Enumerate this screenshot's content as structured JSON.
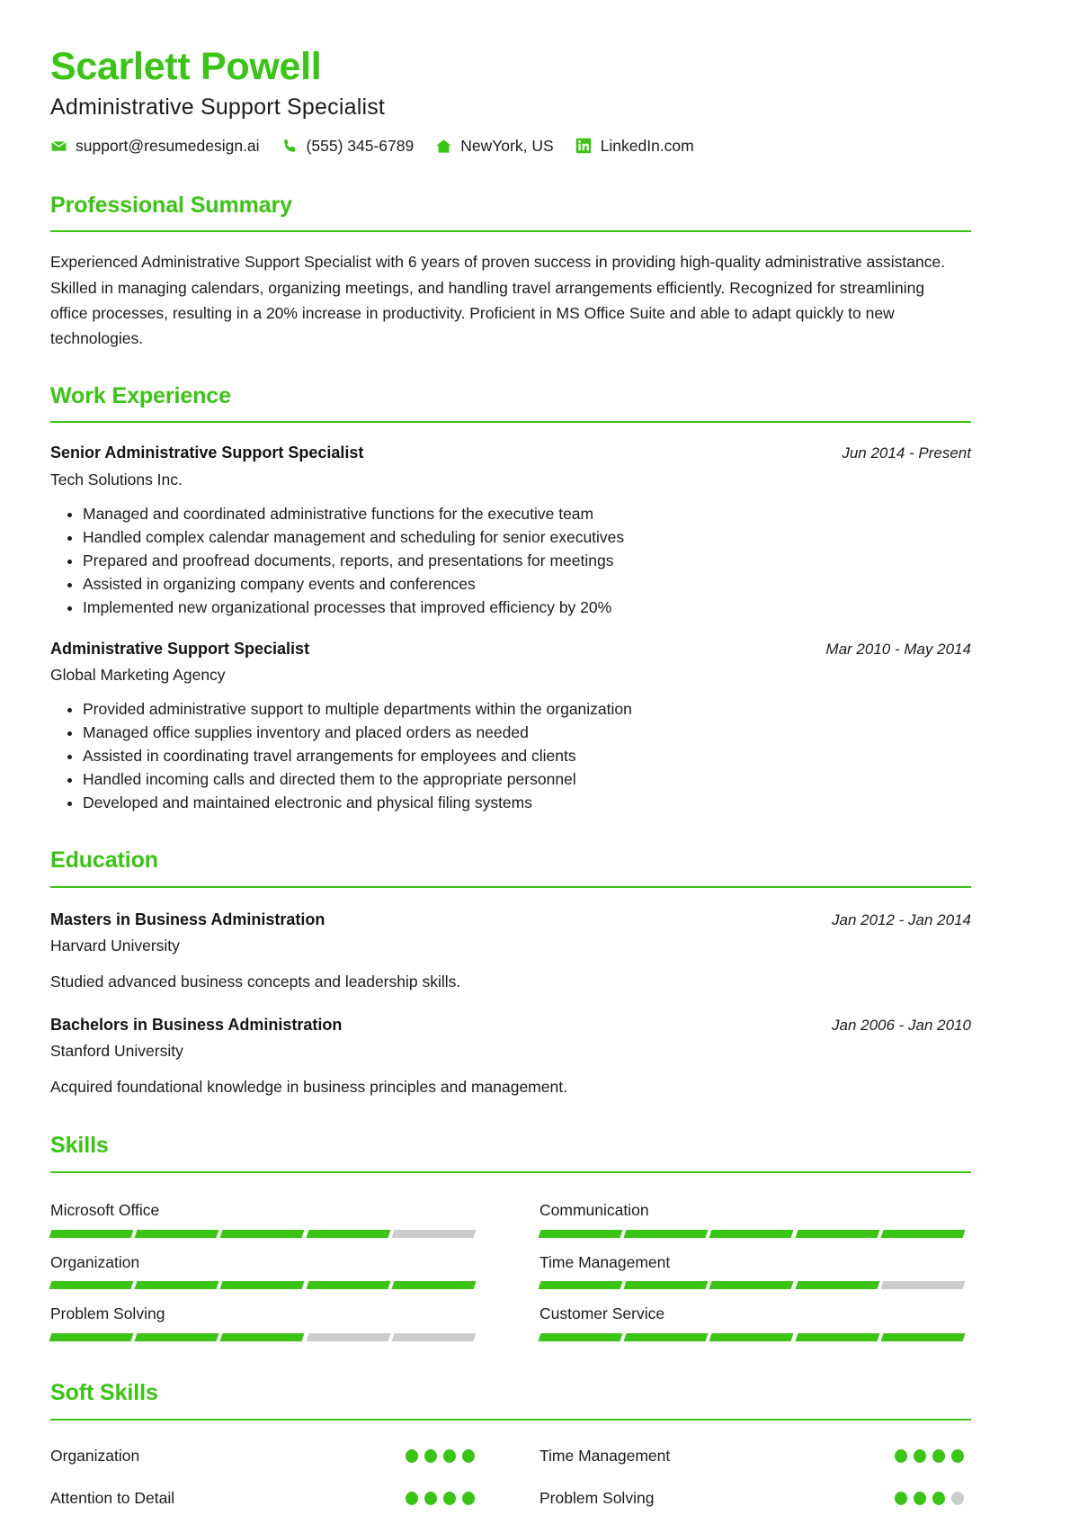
{
  "theme": {
    "accent": "#3ac413",
    "text": "#1c1c1c",
    "muted_bar": "#cccccc"
  },
  "header": {
    "name": "Scarlett Powell",
    "job_title": "Administrative Support Specialist",
    "contacts": [
      {
        "icon": "envelope-icon",
        "text": "support@resumedesign.ai"
      },
      {
        "icon": "phone-icon",
        "text": "(555) 345-6789"
      },
      {
        "icon": "home-icon",
        "text": "NewYork, US"
      },
      {
        "icon": "linkedin-icon",
        "text": "LinkedIn.com"
      }
    ]
  },
  "summary": {
    "heading": "Professional Summary",
    "text": "Experienced Administrative Support Specialist with 6 years of proven success in providing high-quality administrative assistance. Skilled in managing calendars, organizing meetings, and handling travel arrangements efficiently. Recognized for streamlining office processes, resulting in a 20% increase in productivity. Proficient in MS Office Suite and able to adapt quickly to new technologies."
  },
  "work": {
    "heading": "Work Experience",
    "entries": [
      {
        "role": "Senior Administrative Support Specialist",
        "organization": "Tech Solutions Inc.",
        "dates": "Jun 2014 - Present",
        "bullets": [
          "Managed and coordinated administrative functions for the executive team",
          "Handled complex calendar management and scheduling for senior executives",
          "Prepared and proofread documents, reports, and presentations for meetings",
          "Assisted in organizing company events and conferences",
          "Implemented new organizational processes that improved efficiency by 20%"
        ]
      },
      {
        "role": "Administrative Support Specialist",
        "organization": "Global Marketing Agency",
        "dates": "Mar 2010 - May 2014",
        "bullets": [
          "Provided administrative support to multiple departments within the organization",
          "Managed office supplies inventory and placed orders as needed",
          "Assisted in coordinating travel arrangements for employees and clients",
          "Handled incoming calls and directed them to the appropriate personnel",
          "Developed and maintained electronic and physical filing systems"
        ]
      }
    ]
  },
  "education": {
    "heading": "Education",
    "entries": [
      {
        "degree": "Masters in Business Administration",
        "school": "Harvard University",
        "dates": "Jan 2012 - Jan 2014",
        "description": "Studied advanced business concepts and leadership skills."
      },
      {
        "degree": "Bachelors in Business Administration",
        "school": "Stanford University",
        "dates": "Jan 2006 - Jan 2010",
        "description": "Acquired foundational knowledge in business principles and management."
      }
    ]
  },
  "skills": {
    "heading": "Skills",
    "total_segments": 5,
    "items": [
      {
        "name": "Microsoft Office",
        "filled": 4
      },
      {
        "name": "Communication",
        "filled": 5
      },
      {
        "name": "Organization",
        "filled": 5
      },
      {
        "name": "Time Management",
        "filled": 4
      },
      {
        "name": "Problem Solving",
        "filled": 3
      },
      {
        "name": "Customer Service",
        "filled": 5
      }
    ]
  },
  "soft_skills": {
    "heading": "Soft Skills",
    "total_dots": 4,
    "items": [
      {
        "name": "Organization",
        "filled": 4
      },
      {
        "name": "Time Management",
        "filled": 4
      },
      {
        "name": "Attention to Detail",
        "filled": 4
      },
      {
        "name": "Problem Solving",
        "filled": 3
      }
    ]
  }
}
